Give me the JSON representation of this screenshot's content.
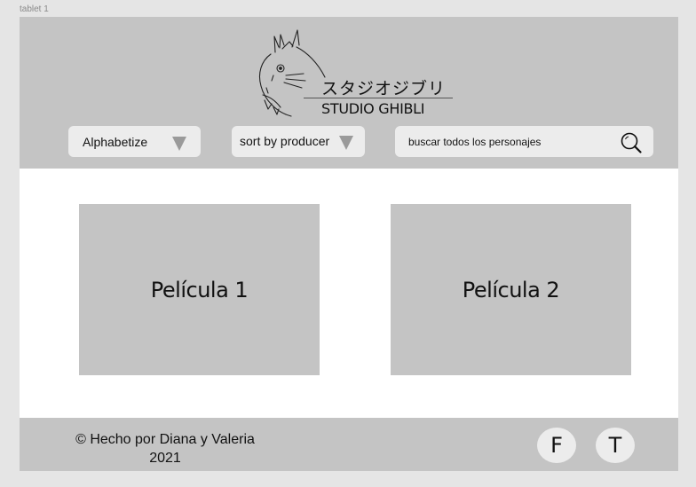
{
  "frame": {
    "label": "tablet 1"
  },
  "logo": {
    "icon": "totoro-icon",
    "japanese": "スタジオジブリ",
    "english": "STUDIO GHIBLI"
  },
  "controls": {
    "alphabetize_label": "Alphabetize",
    "producer_label": "sort by producer",
    "search_placeholder": "buscar todos los personajes",
    "search_icon": "search-icon",
    "dropdown_icon": "triangle-down-icon"
  },
  "films": [
    {
      "title": "Película 1"
    },
    {
      "title": "Película 2"
    }
  ],
  "footer": {
    "credit_line1": "© Hecho por Diana y Valeria",
    "credit_line2": "2021",
    "social": [
      {
        "label": "F"
      },
      {
        "label": "T"
      }
    ]
  },
  "colors": {
    "background": "#e5e5e5",
    "panel": "#c4c4c4",
    "control": "#ececec",
    "card": "#c4c4c4",
    "content": "#ffffff"
  }
}
